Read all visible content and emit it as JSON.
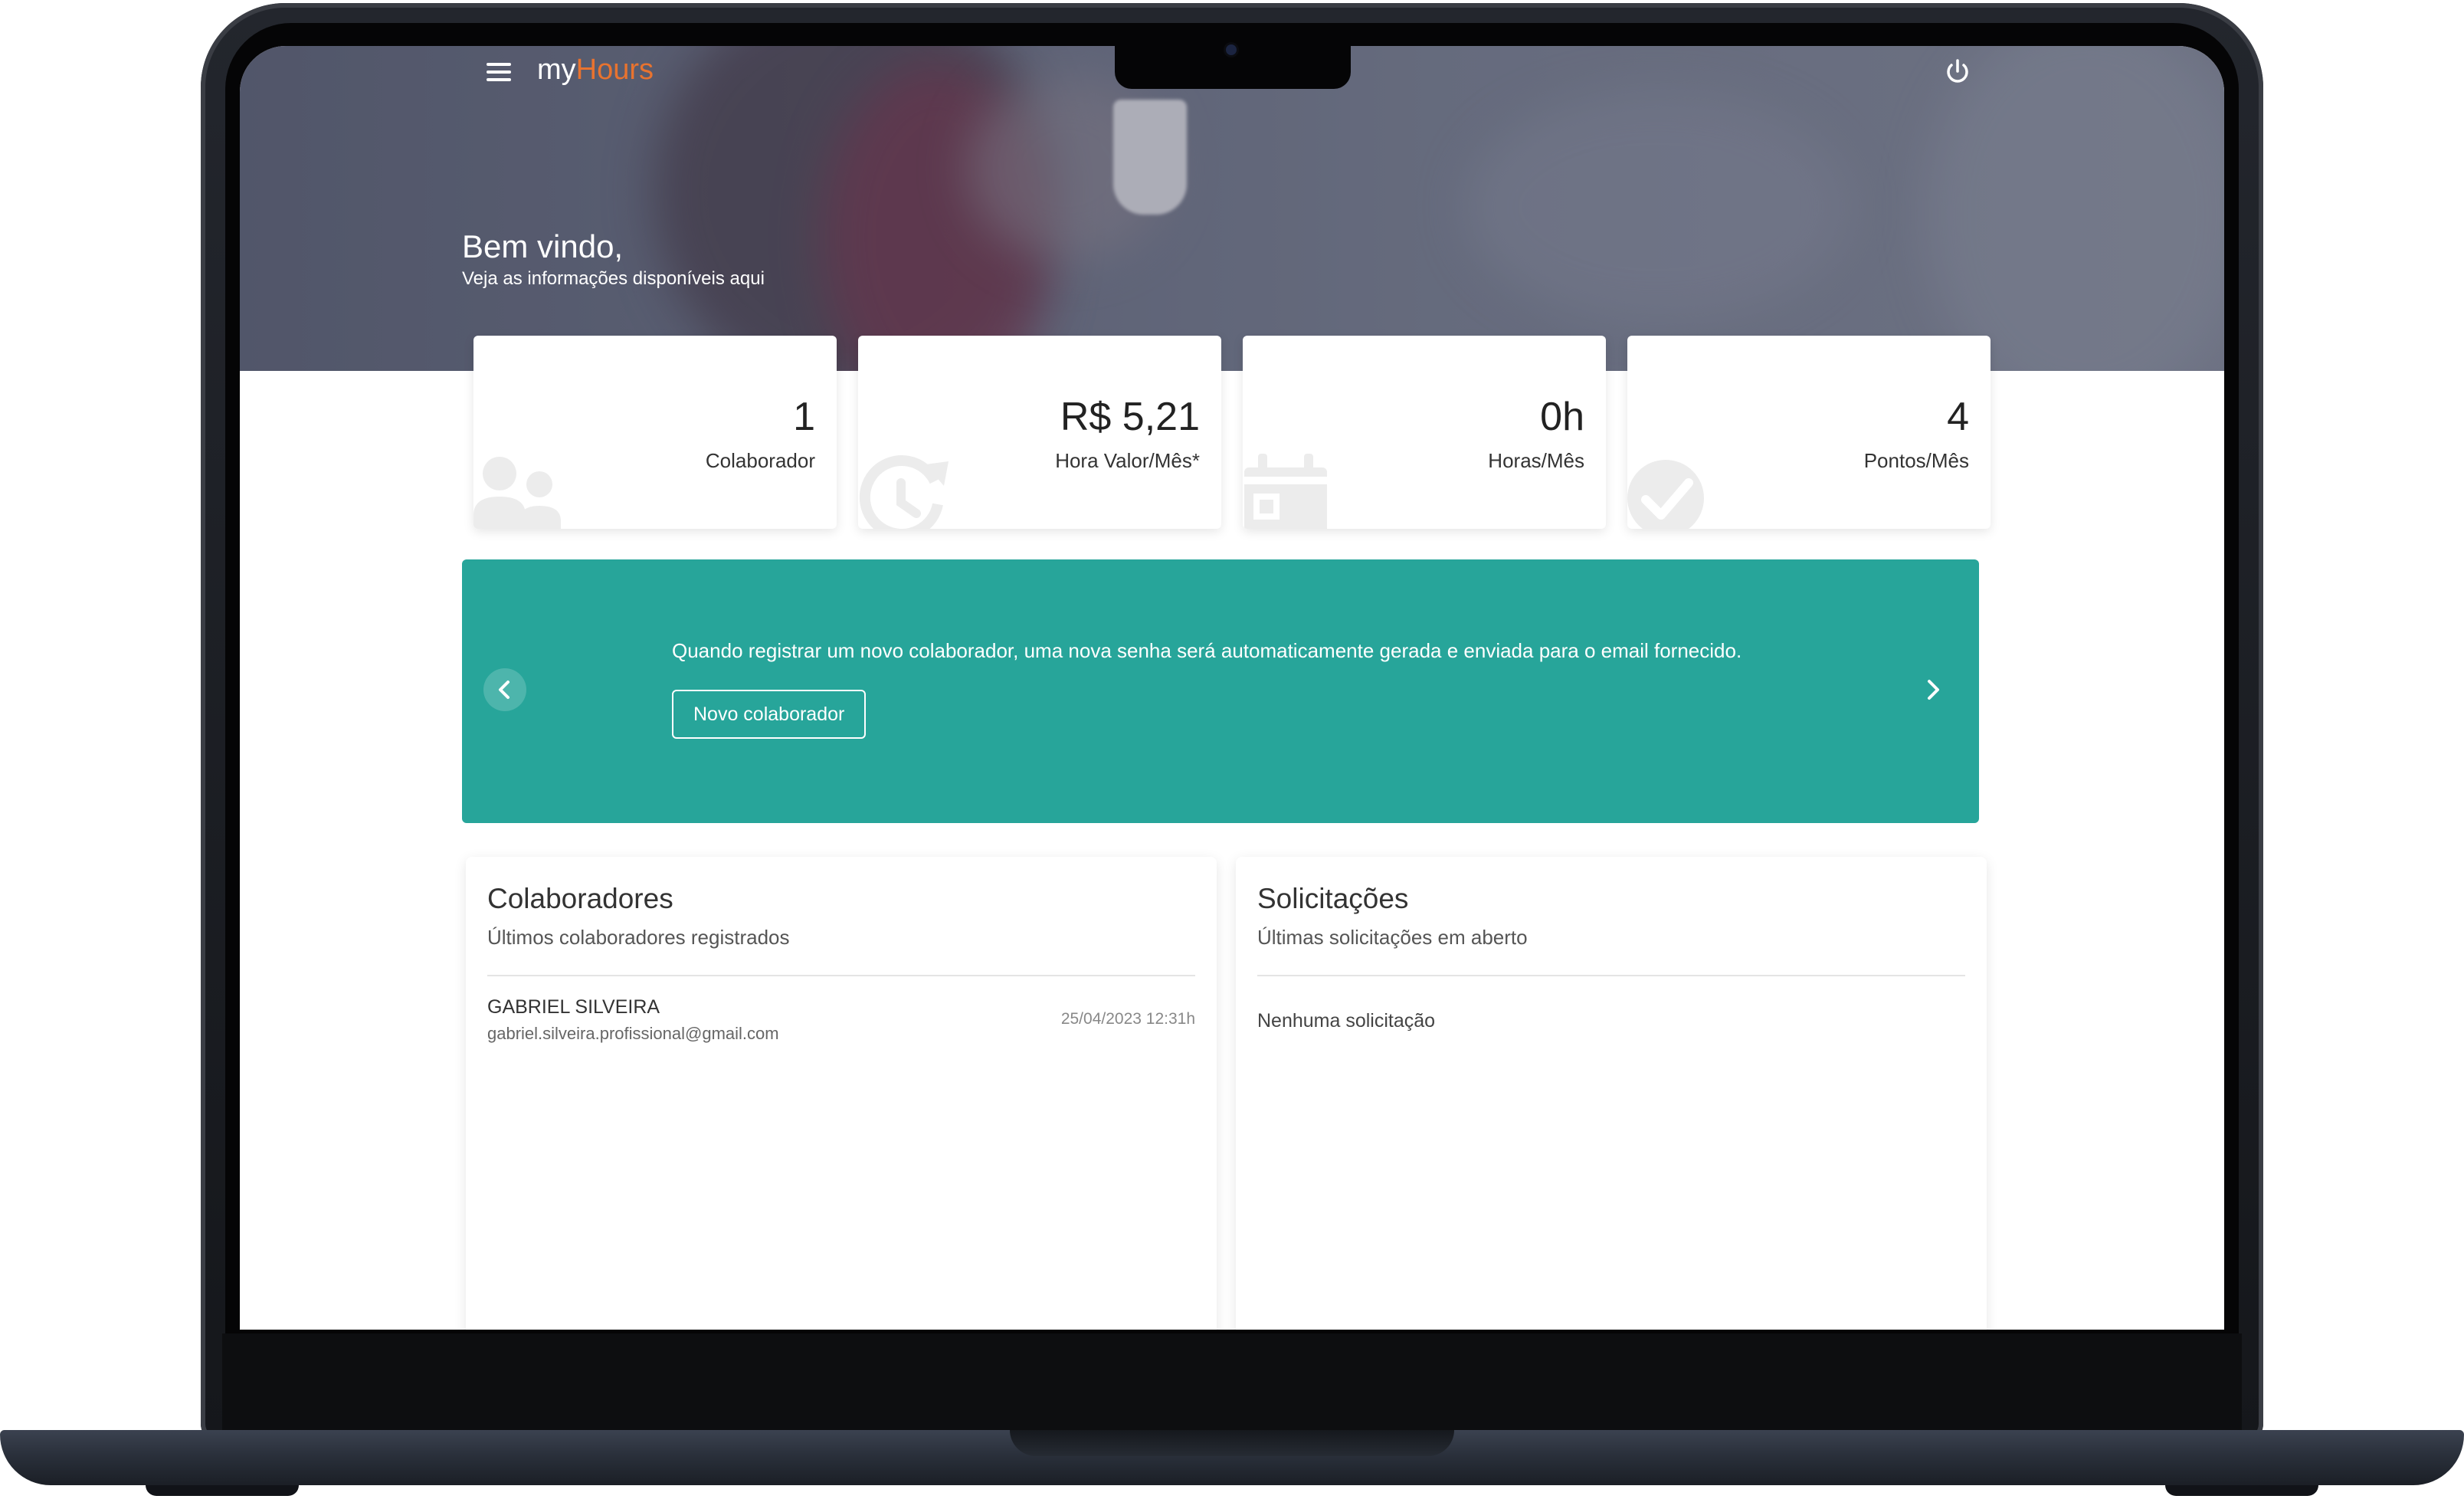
{
  "app": {
    "brand_prefix": "my",
    "brand_suffix": "Hours",
    "accent_color": "#e8732f",
    "primary_color": "#27a59a"
  },
  "header": {
    "welcome_title": "Bem vindo,",
    "welcome_subtitle": "Veja as informações disponíveis aqui"
  },
  "stats": [
    {
      "value": "1",
      "label": "Colaborador",
      "icon": "people-icon"
    },
    {
      "value": "R$ 5,21",
      "label": "Hora Valor/Mês*",
      "icon": "history-clock-icon"
    },
    {
      "value": "0h",
      "label": "Horas/Mês",
      "icon": "calendar-icon"
    },
    {
      "value": "4",
      "label": "Pontos/Mês",
      "icon": "check-circle-icon"
    }
  ],
  "banner": {
    "text": "Quando registrar um novo colaborador, uma nova senha será automaticamente gerada e enviada para o email fornecido.",
    "button_label": "Novo colaborador"
  },
  "collaborators": {
    "title": "Colaboradores",
    "subtitle": "Últimos colaboradores registrados",
    "items": [
      {
        "name": "GABRIEL SILVEIRA",
        "email": "gabriel.silveira.profissional@gmail.com",
        "date": "25/04/2023 12:31h"
      }
    ]
  },
  "requests": {
    "title": "Solicitações",
    "subtitle": "Últimas solicitações em aberto",
    "empty_text": "Nenhuma solicitação"
  }
}
